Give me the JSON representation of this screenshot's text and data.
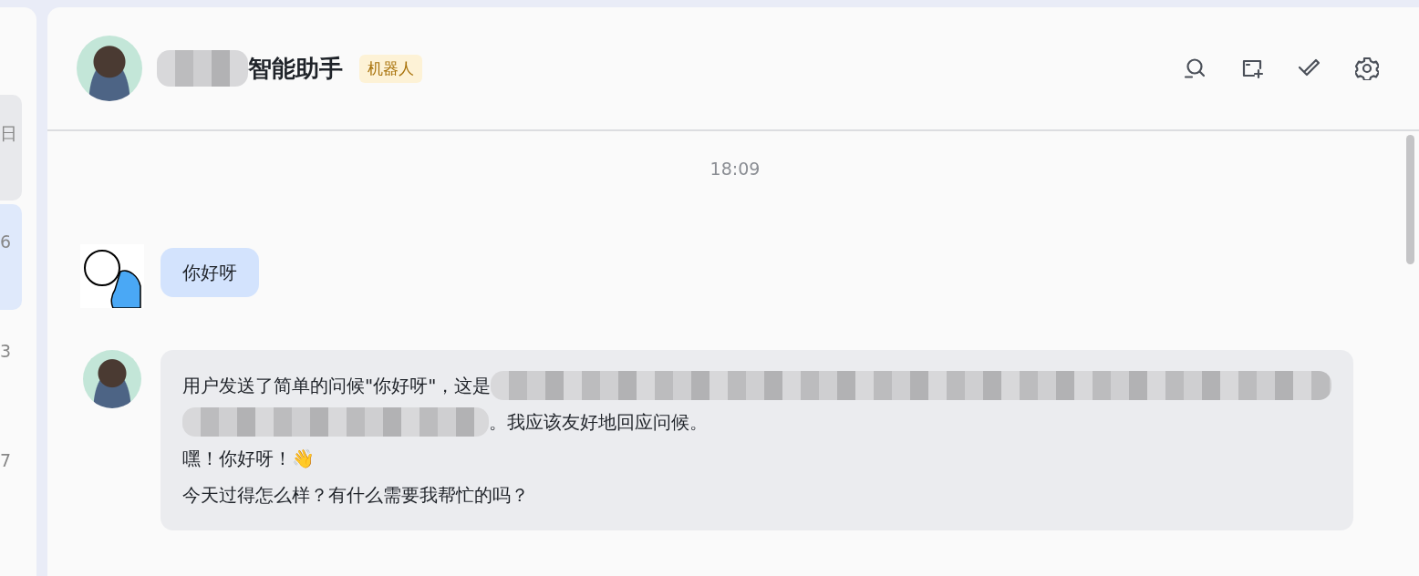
{
  "sidebar": {
    "items": [
      {
        "text": "日",
        "selected": false,
        "highlighted": true
      },
      {
        "text": "6",
        "selected": true,
        "highlighted": false
      },
      {
        "text": "3",
        "selected": false,
        "highlighted": false
      },
      {
        "text": "7",
        "selected": false,
        "highlighted": false
      }
    ]
  },
  "header": {
    "title": [
      {
        "kind": "redacted"
      },
      {
        "kind": "text",
        "text": "智能助手"
      }
    ],
    "badge": "机器人",
    "actions": [
      {
        "kind": "search"
      },
      {
        "kind": "new-chat"
      },
      {
        "kind": "select"
      },
      {
        "kind": "settings"
      }
    ]
  },
  "messages": [
    {
      "kind": "time",
      "text": "18:09"
    },
    {
      "kind": "user",
      "lines": [
        [
          {
            "kind": "text",
            "text": "你好呀"
          }
        ]
      ]
    },
    {
      "kind": "bot",
      "lines": [
        [
          {
            "kind": "text",
            "text": "用户发送了简单的问候\"你好呀\"，这是"
          },
          {
            "kind": "redacted"
          }
        ],
        [
          {
            "kind": "redacted"
          },
          {
            "kind": "text",
            "text": "。我应该友好地回应问候。"
          }
        ],
        [
          {
            "kind": "text",
            "text": "嘿！你好呀！👋"
          }
        ],
        [
          {
            "kind": "text",
            "text": "今天过得怎么样？有什么需要我帮忙的吗？"
          }
        ]
      ]
    }
  ]
}
